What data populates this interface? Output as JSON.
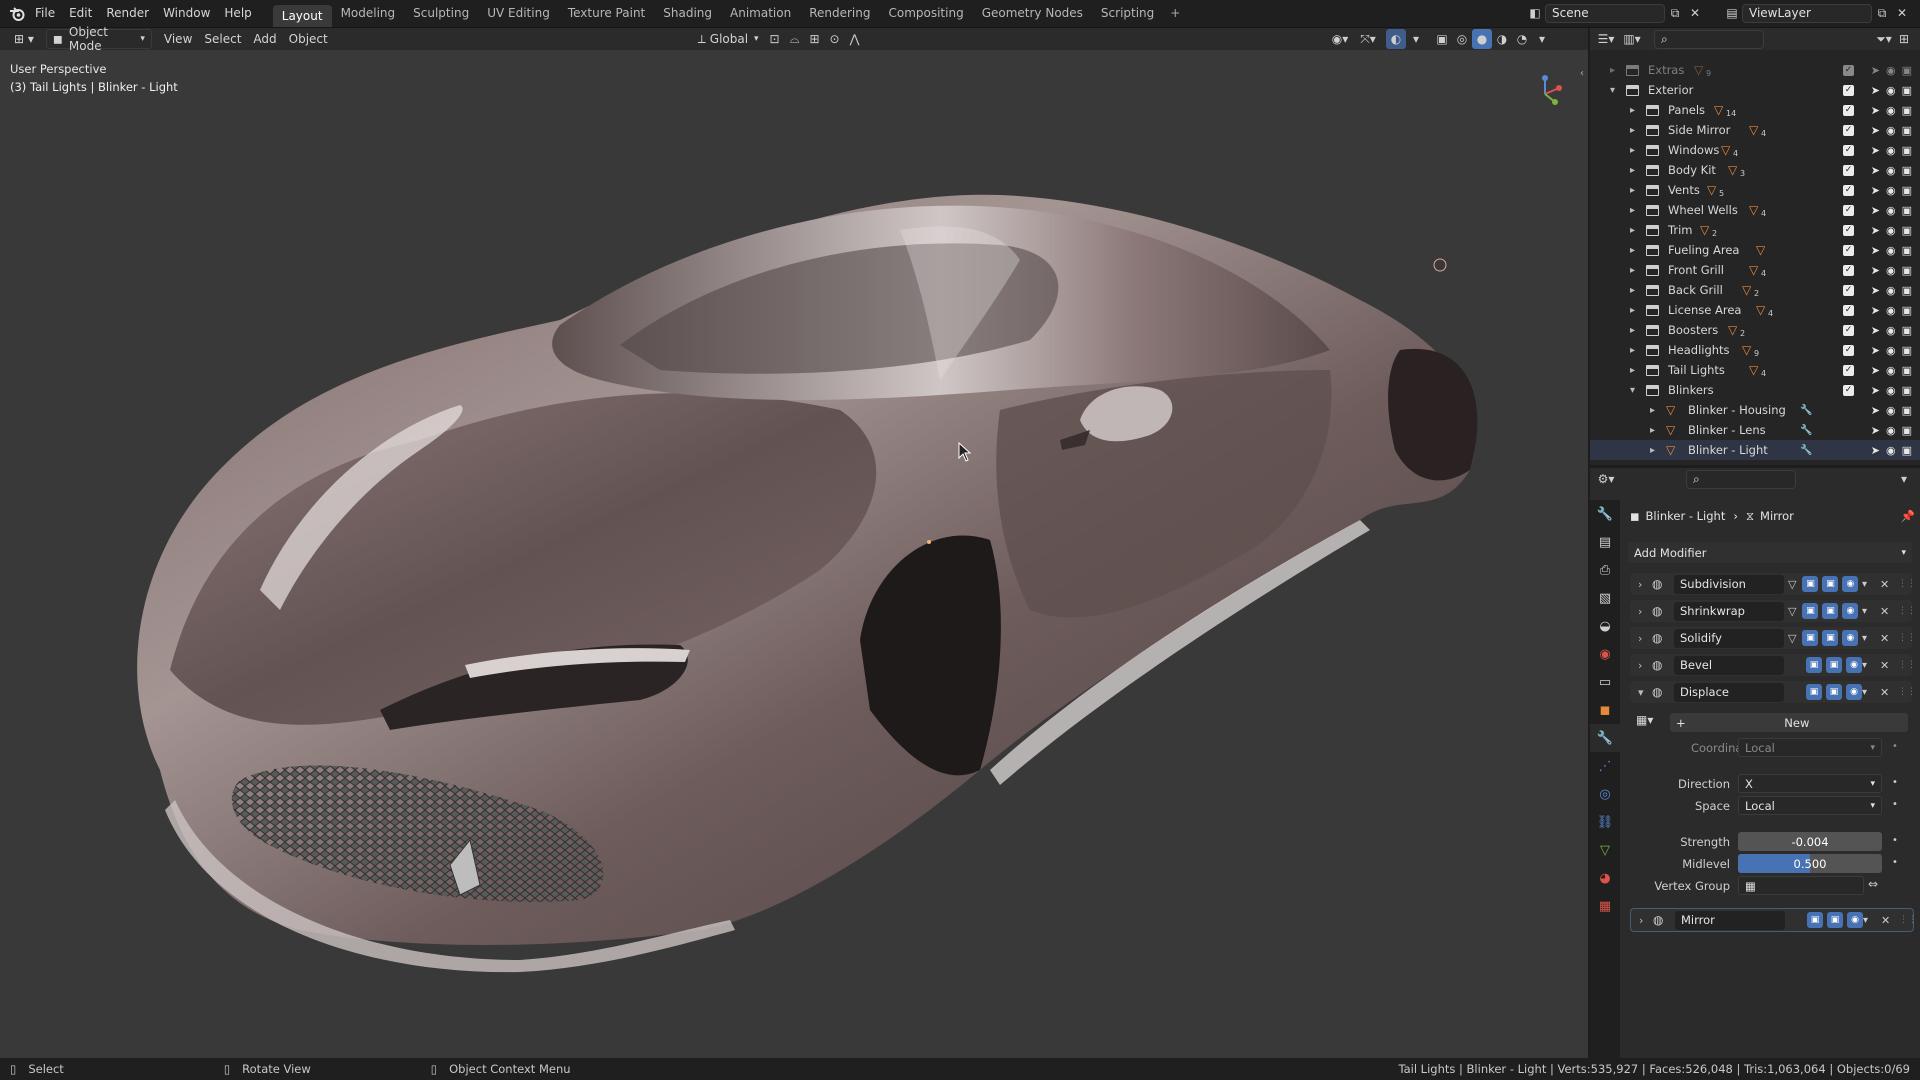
{
  "top_menu": [
    "File",
    "Edit",
    "Render",
    "Window",
    "Help"
  ],
  "workspaces": [
    "Layout",
    "Modeling",
    "Sculpting",
    "UV Editing",
    "Texture Paint",
    "Shading",
    "Animation",
    "Rendering",
    "Compositing",
    "Geometry Nodes",
    "Scripting"
  ],
  "active_workspace": "Layout",
  "scene_name": "Scene",
  "view_layer": "ViewLayer",
  "viewport_header": {
    "mode": "Object Mode",
    "menus": [
      "View",
      "Select",
      "Add",
      "Object"
    ],
    "orientation": "Global"
  },
  "viewport": {
    "perspective_label": "User Perspective",
    "object_label": "(3) Tail Lights | Blinker - Light",
    "background_color": "#393939",
    "car_color": "#8e7a78"
  },
  "outliner": {
    "items": [
      {
        "label": "Extras",
        "count": "9",
        "level": 1,
        "expanded": false,
        "dim": true
      },
      {
        "label": "Exterior",
        "count": "",
        "level": 1,
        "expanded": true
      },
      {
        "label": "Panels",
        "count": "14",
        "level": 2,
        "expanded": false
      },
      {
        "label": "Side Mirror",
        "count": "4",
        "level": 2,
        "expanded": false
      },
      {
        "label": "Windows",
        "count": "4",
        "level": 2,
        "expanded": false
      },
      {
        "label": "Body Kit",
        "count": "3",
        "level": 2,
        "expanded": false
      },
      {
        "label": "Vents",
        "count": "5",
        "level": 2,
        "expanded": false
      },
      {
        "label": "Wheel Wells",
        "count": "4",
        "level": 2,
        "expanded": false
      },
      {
        "label": "Trim",
        "count": "2",
        "level": 2,
        "expanded": false
      },
      {
        "label": "Fueling Area",
        "count": "",
        "level": 2,
        "expanded": false
      },
      {
        "label": "Front Grill",
        "count": "4",
        "level": 2,
        "expanded": false
      },
      {
        "label": "Back Grill",
        "count": "2",
        "level": 2,
        "expanded": false
      },
      {
        "label": "License Area",
        "count": "4",
        "level": 2,
        "expanded": false
      },
      {
        "label": "Boosters",
        "count": "2",
        "level": 2,
        "expanded": false
      },
      {
        "label": "Headlights",
        "count": "9",
        "level": 2,
        "expanded": false
      },
      {
        "label": "Tail Lights",
        "count": "4",
        "level": 2,
        "expanded": false
      },
      {
        "label": "Blinkers",
        "count": "",
        "level": 2,
        "expanded": true
      },
      {
        "label": "Blinker - Housing",
        "count": "",
        "level": 3,
        "object": true
      },
      {
        "label": "Blinker - Lens",
        "count": "",
        "level": 3,
        "object": true
      },
      {
        "label": "Blinker - Light",
        "count": "",
        "level": 3,
        "object": true,
        "selected": true
      }
    ]
  },
  "properties": {
    "breadcrumb_object": "Blinker - Light",
    "breadcrumb_modifier": "Mirror",
    "add_modifier": "Add Modifier",
    "modifiers": [
      {
        "name": "Subdivision",
        "icon": "subdivision-icon"
      },
      {
        "name": "Shrinkwrap",
        "icon": "shrinkwrap-icon"
      },
      {
        "name": "Solidify",
        "icon": "solidify-icon"
      },
      {
        "name": "Bevel",
        "icon": "bevel-icon"
      },
      {
        "name": "Displace",
        "icon": "displace-icon",
        "expanded": true
      },
      {
        "name": "Mirror",
        "icon": "mirror-icon"
      }
    ],
    "displace": {
      "texture_new": "New",
      "coordinates_label": "Coordinates",
      "coordinates_value": "Local",
      "direction_label": "Direction",
      "direction_value": "X",
      "space_label": "Space",
      "space_value": "Local",
      "strength_label": "Strength",
      "strength_value": "-0.004",
      "midlevel_label": "Midlevel",
      "midlevel_value": "0.500",
      "midlevel_fraction": 0.5,
      "vertex_group_label": "Vertex Group"
    }
  },
  "statusbar": {
    "left": [
      "Select",
      "Rotate View",
      "Object Context Menu"
    ],
    "stats": "Tail Lights | Blinker - Light | Verts:535,927 | Faces:526,048 | Tris:1,063,064 | Objects:0/69"
  },
  "colors": {
    "accent": "#4772b3",
    "orange": "#e8883a"
  }
}
